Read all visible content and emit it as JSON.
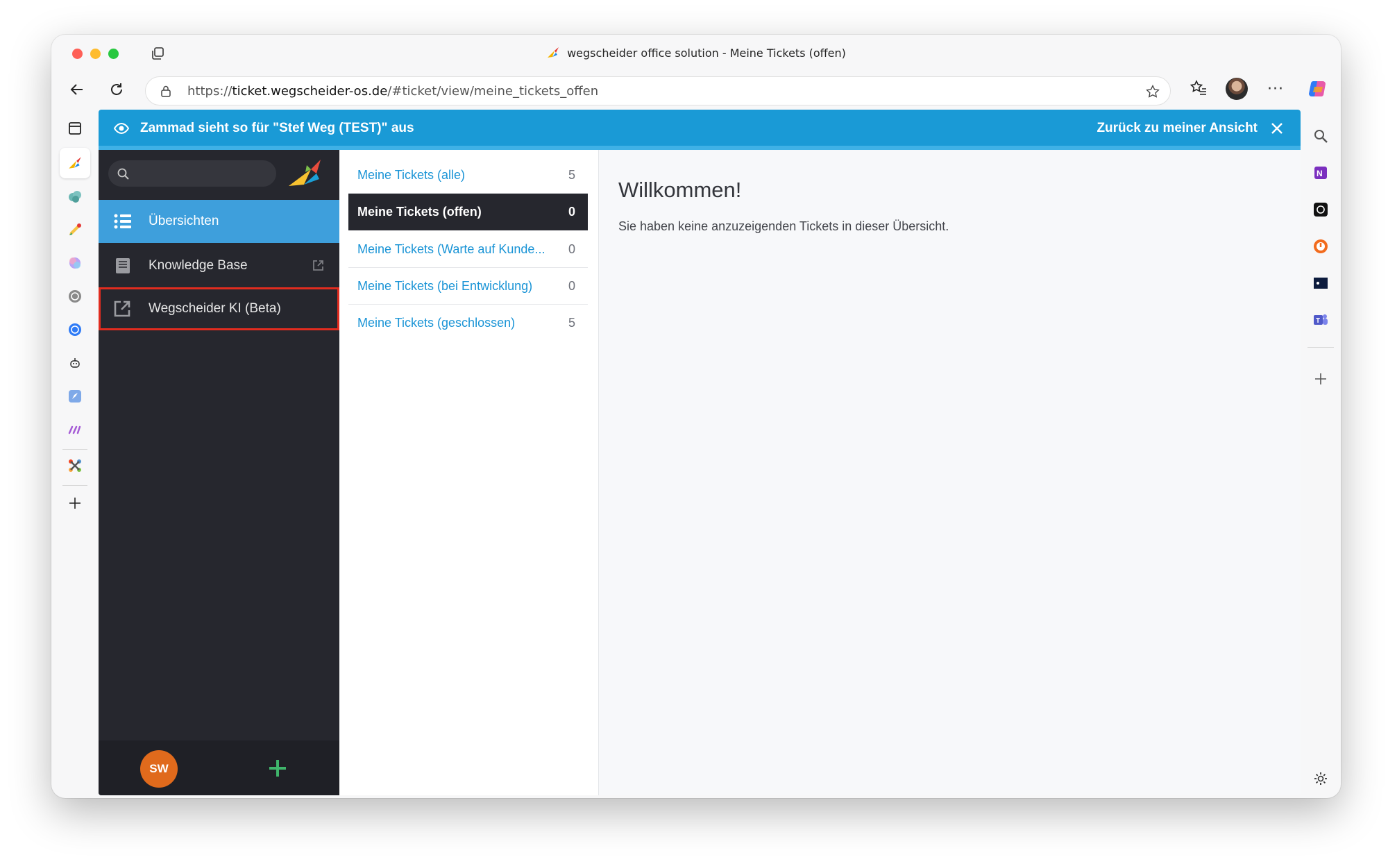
{
  "window": {
    "title": "wegscheider office solution - Meine Tickets (offen)"
  },
  "address_bar": {
    "scheme": "https://",
    "domain": "ticket.wegscheider-os.de",
    "path": "/#ticket/view/meine_tickets_offen"
  },
  "browser_left_sidebar": {
    "items": [
      "tabs-panel-icon",
      "zammad-app-icon",
      "cloud-app-icon",
      "pencil-app-icon",
      "copilot-app-icon",
      "chatgpt-app-icon",
      "openai-app-icon",
      "robot-app-icon",
      "rocket-app-icon",
      "make-app-icon",
      "joomla-app-icon",
      "add-icon"
    ]
  },
  "browser_right_sidebar": {
    "items": [
      "search-icon",
      "onenote-icon",
      "chatgpt-icon",
      "power-icon",
      "dark-app-icon",
      "teams-icon",
      "add-icon",
      "settings-icon"
    ]
  },
  "banner": {
    "text": "Zammad sieht so für \"Stef Weg (TEST)\" aus",
    "back_label": "Zurück zu meiner Ansicht",
    "color": "#1a9ad6"
  },
  "nav": {
    "items": [
      {
        "label": "Übersichten",
        "icon": "list-icon",
        "active": true
      },
      {
        "label": "Knowledge Base",
        "icon": "book-icon",
        "external": true
      },
      {
        "label": "Wegscheider KI (Beta)",
        "icon": "external-link-icon",
        "highlighted": true
      }
    ],
    "user_initials": "SW"
  },
  "overviews": {
    "items": [
      {
        "label": "Meine Tickets (alle)",
        "count": "5"
      },
      {
        "label": "Meine Tickets (offen)",
        "count": "0",
        "active": true
      },
      {
        "label": "Meine Tickets (Warte auf Kunde...",
        "count": "0"
      },
      {
        "label": "Meine Tickets (bei Entwicklung)",
        "count": "0"
      },
      {
        "label": "Meine Tickets (geschlossen)",
        "count": "5"
      }
    ]
  },
  "content": {
    "heading": "Willkommen!",
    "message": "Sie haben keine anzuzeigenden Tickets in dieser Übersicht."
  },
  "colors": {
    "accent": "#3e9fdc",
    "link": "#1a94d6",
    "nav_bg": "#26272e",
    "highlight_outline": "#e12c1f",
    "avatar": "#e06a1c",
    "add_button": "#3fb56b"
  }
}
